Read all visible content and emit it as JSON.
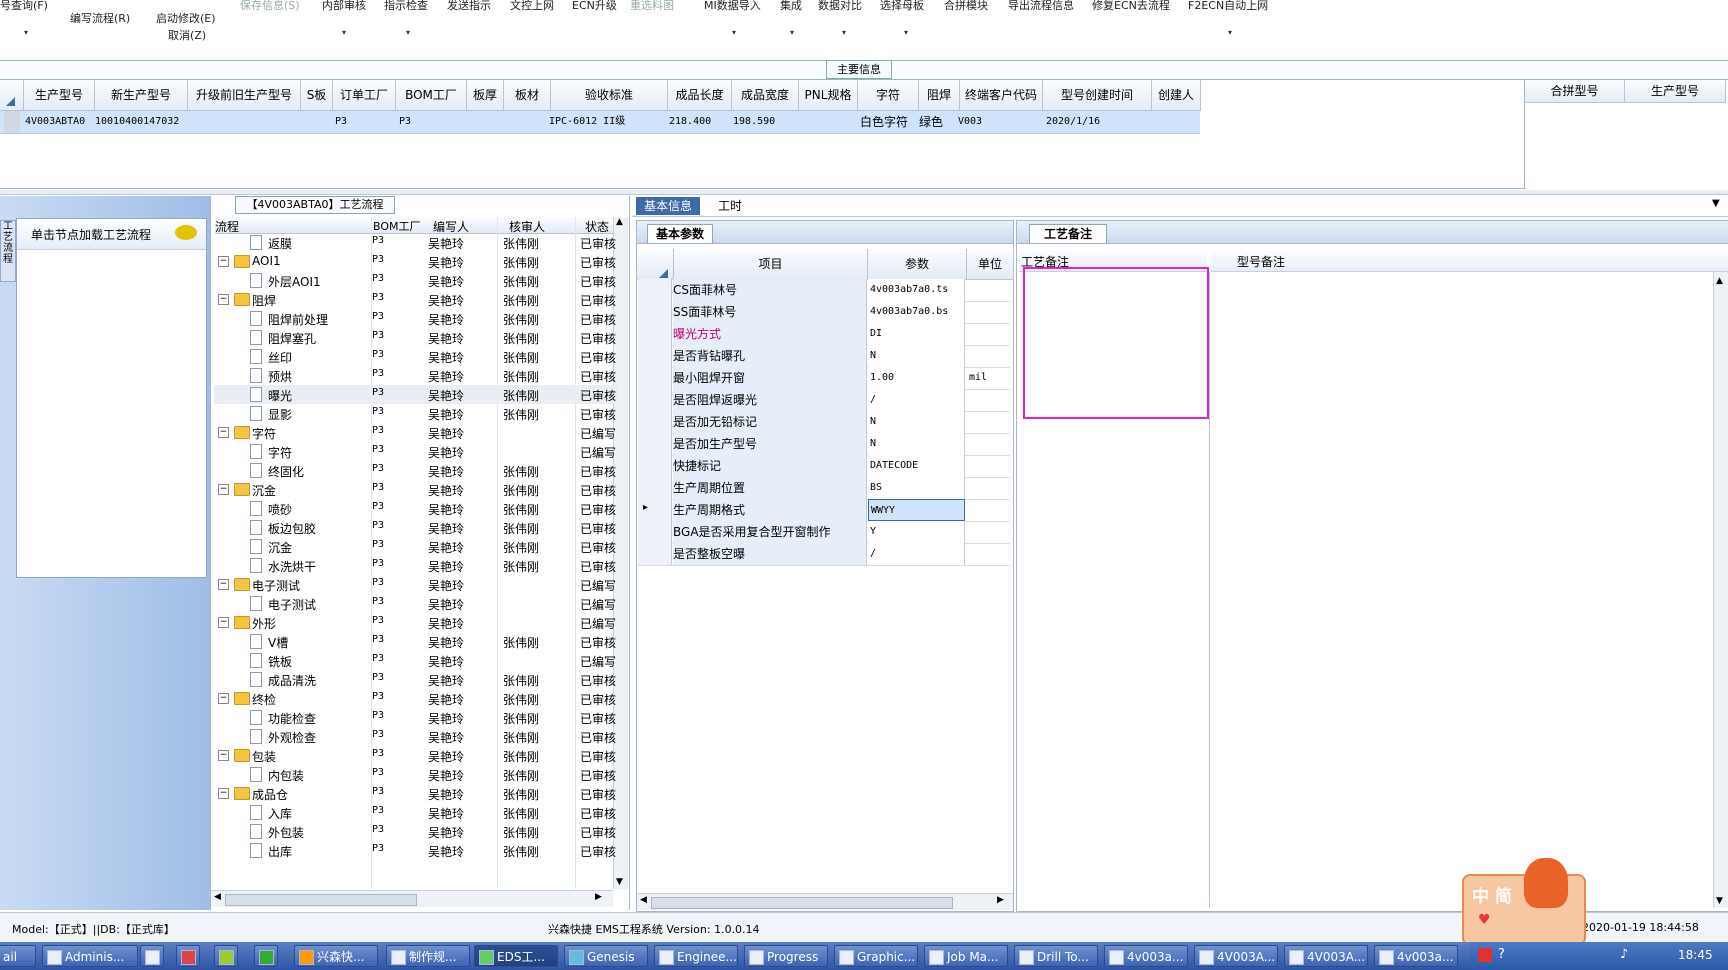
{
  "toolbar": {
    "items": [
      {
        "label": "号查询(F)",
        "disabled": false
      },
      {
        "label": "编写流程(R)",
        "disabled": false
      },
      {
        "label": "启动修改(E)",
        "disabled": false
      },
      {
        "label": "取消(Z)",
        "disabled": false
      },
      {
        "label": "保存信息(S)",
        "disabled": true
      },
      {
        "label": "内部审核",
        "disabled": false
      },
      {
        "label": "指示检查",
        "disabled": false
      },
      {
        "label": "发送指示",
        "disabled": false
      },
      {
        "label": "文控上网",
        "disabled": false
      },
      {
        "label": "ECN升级",
        "disabled": false
      },
      {
        "label": "重选料图",
        "disabled": true
      },
      {
        "label": "MI数据导入",
        "disabled": false
      },
      {
        "label": "集成",
        "disabled": false
      },
      {
        "label": "数据对比",
        "disabled": false
      },
      {
        "label": "选择母板",
        "disabled": false
      },
      {
        "label": "合拼模块",
        "disabled": false
      },
      {
        "label": "导出流程信息",
        "disabled": false
      },
      {
        "label": "修复ECN去流程",
        "disabled": false
      },
      {
        "label": "F2ECN自动上网",
        "disabled": false
      }
    ]
  },
  "main_info": {
    "title": "主要信息",
    "columns": [
      "生产型号",
      "新生产型号",
      "升级前旧生产型号",
      "S板",
      "订单工厂",
      "BOM工厂",
      "板厚",
      "板材",
      "验收标准",
      "成品长度",
      "成品宽度",
      "PNL规格",
      "字符",
      "阻焊",
      "终端客户代码",
      "型号创建时间",
      "创建人"
    ],
    "row": [
      "4V003ABTA0",
      "10010400147032",
      "",
      "",
      "P3",
      "P3",
      "",
      "",
      "IPC-6012 II级",
      "218.400",
      "198.590",
      "",
      "白色字符",
      "绿色",
      "V003",
      "2020/1/16",
      ""
    ],
    "side_columns": [
      "合拼型号",
      "生产型号"
    ]
  },
  "left_panel": {
    "vertical_tab": "工艺流程",
    "load_text": "单击节点加载工艺流程"
  },
  "process_flow": {
    "title": "【4V003ABTA0】工艺流程",
    "columns": [
      "流程",
      "BOM工厂",
      "编写人",
      "核审人",
      "状态"
    ],
    "rows": [
      {
        "level": 1,
        "type": "page",
        "name": "返膜",
        "bom": "P3",
        "writer": "吴艳玲",
        "reviewer": "张伟刚",
        "status": "已审核"
      },
      {
        "level": 0,
        "type": "folder",
        "name": "AOI1",
        "bom": "P3",
        "writer": "吴艳玲",
        "reviewer": "张伟刚",
        "status": "已审核"
      },
      {
        "level": 1,
        "type": "page",
        "name": "外层AOI1",
        "bom": "P3",
        "writer": "吴艳玲",
        "reviewer": "张伟刚",
        "status": "已审核"
      },
      {
        "level": 0,
        "type": "folder",
        "name": "阻焊",
        "bom": "P3",
        "writer": "吴艳玲",
        "reviewer": "张伟刚",
        "status": "已审核"
      },
      {
        "level": 1,
        "type": "page",
        "name": "阻焊前处理",
        "bom": "P3",
        "writer": "吴艳玲",
        "reviewer": "张伟刚",
        "status": "已审核"
      },
      {
        "level": 1,
        "type": "page",
        "name": "阻焊塞孔",
        "bom": "P3",
        "writer": "吴艳玲",
        "reviewer": "张伟刚",
        "status": "已审核"
      },
      {
        "level": 1,
        "type": "page",
        "name": "丝印",
        "bom": "P3",
        "writer": "吴艳玲",
        "reviewer": "张伟刚",
        "status": "已审核"
      },
      {
        "level": 1,
        "type": "page",
        "name": "预烘",
        "bom": "P3",
        "writer": "吴艳玲",
        "reviewer": "张伟刚",
        "status": "已审核"
      },
      {
        "level": 1,
        "type": "page",
        "name": "曝光",
        "bom": "P3",
        "writer": "吴艳玲",
        "reviewer": "张伟刚",
        "status": "已审核",
        "selected": true
      },
      {
        "level": 1,
        "type": "page",
        "name": "显影",
        "bom": "P3",
        "writer": "吴艳玲",
        "reviewer": "张伟刚",
        "status": "已审核"
      },
      {
        "level": 0,
        "type": "folder",
        "name": "字符",
        "bom": "P3",
        "writer": "吴艳玲",
        "reviewer": "",
        "status": "已编写"
      },
      {
        "level": 1,
        "type": "page",
        "name": "字符",
        "bom": "P3",
        "writer": "吴艳玲",
        "reviewer": "",
        "status": "已编写"
      },
      {
        "level": 1,
        "type": "page",
        "name": "终固化",
        "bom": "P3",
        "writer": "吴艳玲",
        "reviewer": "张伟刚",
        "status": "已审核"
      },
      {
        "level": 0,
        "type": "folder",
        "name": "沉金",
        "bom": "P3",
        "writer": "吴艳玲",
        "reviewer": "张伟刚",
        "status": "已审核"
      },
      {
        "level": 1,
        "type": "page",
        "name": "喷砂",
        "bom": "P3",
        "writer": "吴艳玲",
        "reviewer": "张伟刚",
        "status": "已审核"
      },
      {
        "level": 1,
        "type": "page",
        "name": "板边包胶",
        "bom": "P3",
        "writer": "吴艳玲",
        "reviewer": "张伟刚",
        "status": "已审核"
      },
      {
        "level": 1,
        "type": "page",
        "name": "沉金",
        "bom": "P3",
        "writer": "吴艳玲",
        "reviewer": "张伟刚",
        "status": "已审核"
      },
      {
        "level": 1,
        "type": "page",
        "name": "水洗烘干",
        "bom": "P3",
        "writer": "吴艳玲",
        "reviewer": "张伟刚",
        "status": "已审核"
      },
      {
        "level": 0,
        "type": "folder",
        "name": "电子测试",
        "bom": "P3",
        "writer": "吴艳玲",
        "reviewer": "",
        "status": "已编写"
      },
      {
        "level": 1,
        "type": "page",
        "name": "电子测试",
        "bom": "P3",
        "writer": "吴艳玲",
        "reviewer": "",
        "status": "已编写"
      },
      {
        "level": 0,
        "type": "folder",
        "name": "外形",
        "bom": "P3",
        "writer": "吴艳玲",
        "reviewer": "",
        "status": "已编写"
      },
      {
        "level": 1,
        "type": "page",
        "name": "V槽",
        "bom": "P3",
        "writer": "吴艳玲",
        "reviewer": "张伟刚",
        "status": "已审核"
      },
      {
        "level": 1,
        "type": "page",
        "name": "铣板",
        "bom": "P3",
        "writer": "吴艳玲",
        "reviewer": "",
        "status": "已编写"
      },
      {
        "level": 1,
        "type": "page",
        "name": "成品清洗",
        "bom": "P3",
        "writer": "吴艳玲",
        "reviewer": "张伟刚",
        "status": "已审核"
      },
      {
        "level": 0,
        "type": "folder",
        "name": "终检",
        "bom": "P3",
        "writer": "吴艳玲",
        "reviewer": "张伟刚",
        "status": "已审核"
      },
      {
        "level": 1,
        "type": "page",
        "name": "功能检查",
        "bom": "P3",
        "writer": "吴艳玲",
        "reviewer": "张伟刚",
        "status": "已审核"
      },
      {
        "level": 1,
        "type": "page",
        "name": "外观检查",
        "bom": "P3",
        "writer": "吴艳玲",
        "reviewer": "张伟刚",
        "status": "已审核"
      },
      {
        "level": 0,
        "type": "folder",
        "name": "包装",
        "bom": "P3",
        "writer": "吴艳玲",
        "reviewer": "张伟刚",
        "status": "已审核"
      },
      {
        "level": 1,
        "type": "page",
        "name": "内包装",
        "bom": "P3",
        "writer": "吴艳玲",
        "reviewer": "张伟刚",
        "status": "已审核"
      },
      {
        "level": 0,
        "type": "folder",
        "name": "成品仓",
        "bom": "P3",
        "writer": "吴艳玲",
        "reviewer": "张伟刚",
        "status": "已审核"
      },
      {
        "level": 1,
        "type": "page",
        "name": "入库",
        "bom": "P3",
        "writer": "吴艳玲",
        "reviewer": "张伟刚",
        "status": "已审核"
      },
      {
        "level": 1,
        "type": "page",
        "name": "外包装",
        "bom": "P3",
        "writer": "吴艳玲",
        "reviewer": "张伟刚",
        "status": "已审核"
      },
      {
        "level": 1,
        "type": "page",
        "name": "出库",
        "bom": "P3",
        "writer": "吴艳玲",
        "reviewer": "张伟刚",
        "status": "已审核"
      }
    ]
  },
  "detail_tabs": [
    "基本信息",
    "工时"
  ],
  "basic_params": {
    "tab": "基本参数",
    "columns": [
      "项目",
      "参数",
      "单位"
    ],
    "rows": [
      {
        "name": "CS面菲林号",
        "value": "4v003ab7a0.ts",
        "unit": ""
      },
      {
        "name": "SS面菲林号",
        "value": "4v003ab7a0.bs",
        "unit": ""
      },
      {
        "name": "曝光方式",
        "value": "DI",
        "unit": "",
        "highlight": true
      },
      {
        "name": "是否背钻曝孔",
        "value": "N",
        "unit": ""
      },
      {
        "name": "最小阻焊开窗",
        "value": "1.00",
        "unit": "mil"
      },
      {
        "name": "是否阻焊返曝光",
        "value": "/",
        "unit": ""
      },
      {
        "name": "是否加无铅标记",
        "value": "N",
        "unit": ""
      },
      {
        "name": "是否加生产型号",
        "value": "N",
        "unit": ""
      },
      {
        "name": "快捷标记",
        "value": "DATECODE",
        "unit": ""
      },
      {
        "name": "生产周期位置",
        "value": "BS",
        "unit": ""
      },
      {
        "name": "生产周期格式",
        "value": "WWYY",
        "unit": "",
        "current": true
      },
      {
        "name": "BGA是否采用复合型开窗制作",
        "value": "Y",
        "unit": ""
      },
      {
        "name": "是否整板空曝",
        "value": "/",
        "unit": ""
      }
    ]
  },
  "remarks": {
    "tab": "工艺备注",
    "process_remark_label": "工艺备注",
    "model_remark_label": "型号备注"
  },
  "status_bar": {
    "model": "Model:【正式】||DB:【正式库】",
    "app": "兴森快捷 EMS工程系统 Version: 1.0.0.14",
    "datetime": "2020-01-19 18:44:58"
  },
  "ime": {
    "text": "中 简"
  },
  "taskbar": {
    "items": [
      "ail",
      "Adminis...",
      "",
      "",
      "",
      "",
      "兴森快...",
      "制作规...",
      "EDS工...",
      "Genesis",
      "Enginee...",
      "Progress",
      "Graphic...",
      "Job Ma...",
      "Drill To...",
      "4v003a...",
      "4V003A...",
      "4V003A...",
      "4v003a..."
    ],
    "clock": "18:45"
  },
  "colors": {
    "highlight_row": "#cfe3fa",
    "selection_box": "#e020d0",
    "param_name_red": "#c0006a",
    "taskbar": "#3a62b0"
  }
}
